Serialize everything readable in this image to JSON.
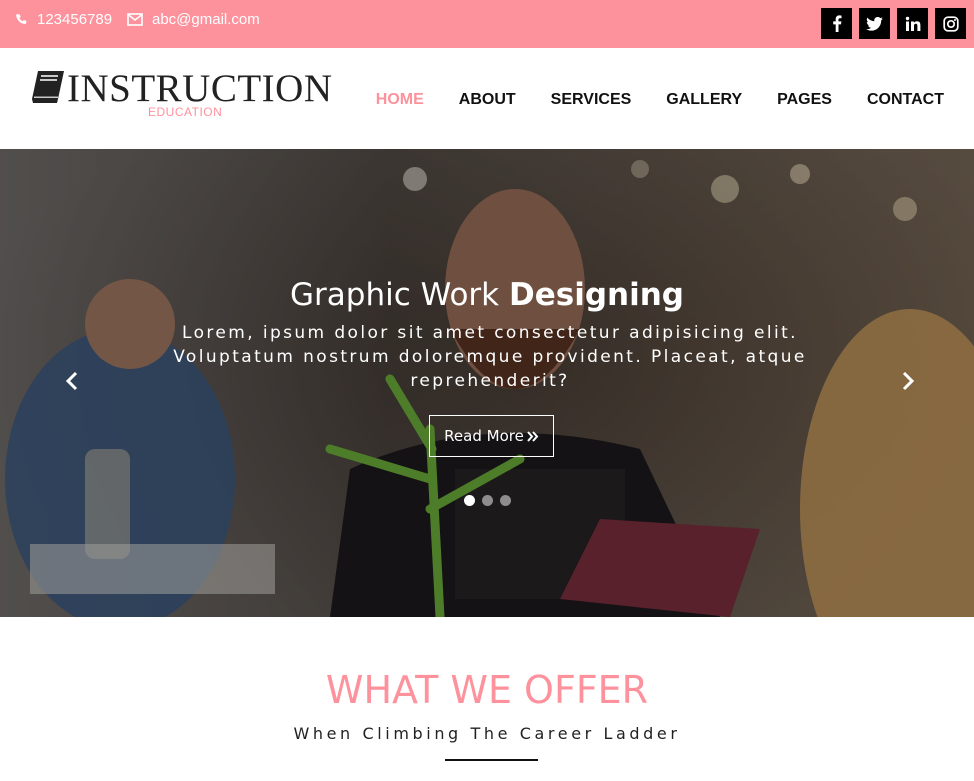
{
  "topbar": {
    "phone": "123456789",
    "email": "abc@gmail.com",
    "socials": [
      {
        "icon": "facebook-icon",
        "glyph": "f"
      },
      {
        "icon": "twitter-icon",
        "glyph": "t"
      },
      {
        "icon": "linkedin-icon",
        "glyph": "in"
      },
      {
        "icon": "instagram-icon",
        "glyph": "ig"
      }
    ]
  },
  "brand": {
    "title": "INSTRUCTION",
    "subtitle": "EDUCATION",
    "icon": "book-icon"
  },
  "nav": {
    "items": [
      {
        "label": "HOME",
        "active": true
      },
      {
        "label": "ABOUT"
      },
      {
        "label": "SERVICES"
      },
      {
        "label": "GALLERY"
      },
      {
        "label": "PAGES"
      },
      {
        "label": "CONTACT"
      }
    ]
  },
  "hero": {
    "title_light": "Graphic Work ",
    "title_bold": "Designing",
    "text": "Lorem, ipsum dolor sit amet consectetur adipisicing elit. Voluptatum nostrum doloremque provident. Placeat, atque reprehenderit?",
    "button_label": "Read More",
    "button_icon": "double-chevron-right-icon",
    "prev_icon": "chevron-left-icon",
    "next_icon": "chevron-right-icon",
    "slides_count": 3,
    "active_slide": 1
  },
  "offer": {
    "title": "WHAT WE OFFER",
    "subtitle": "When Climbing The Career Ladder"
  },
  "colors": {
    "accent": "#fd929d",
    "dark": "#000000"
  }
}
